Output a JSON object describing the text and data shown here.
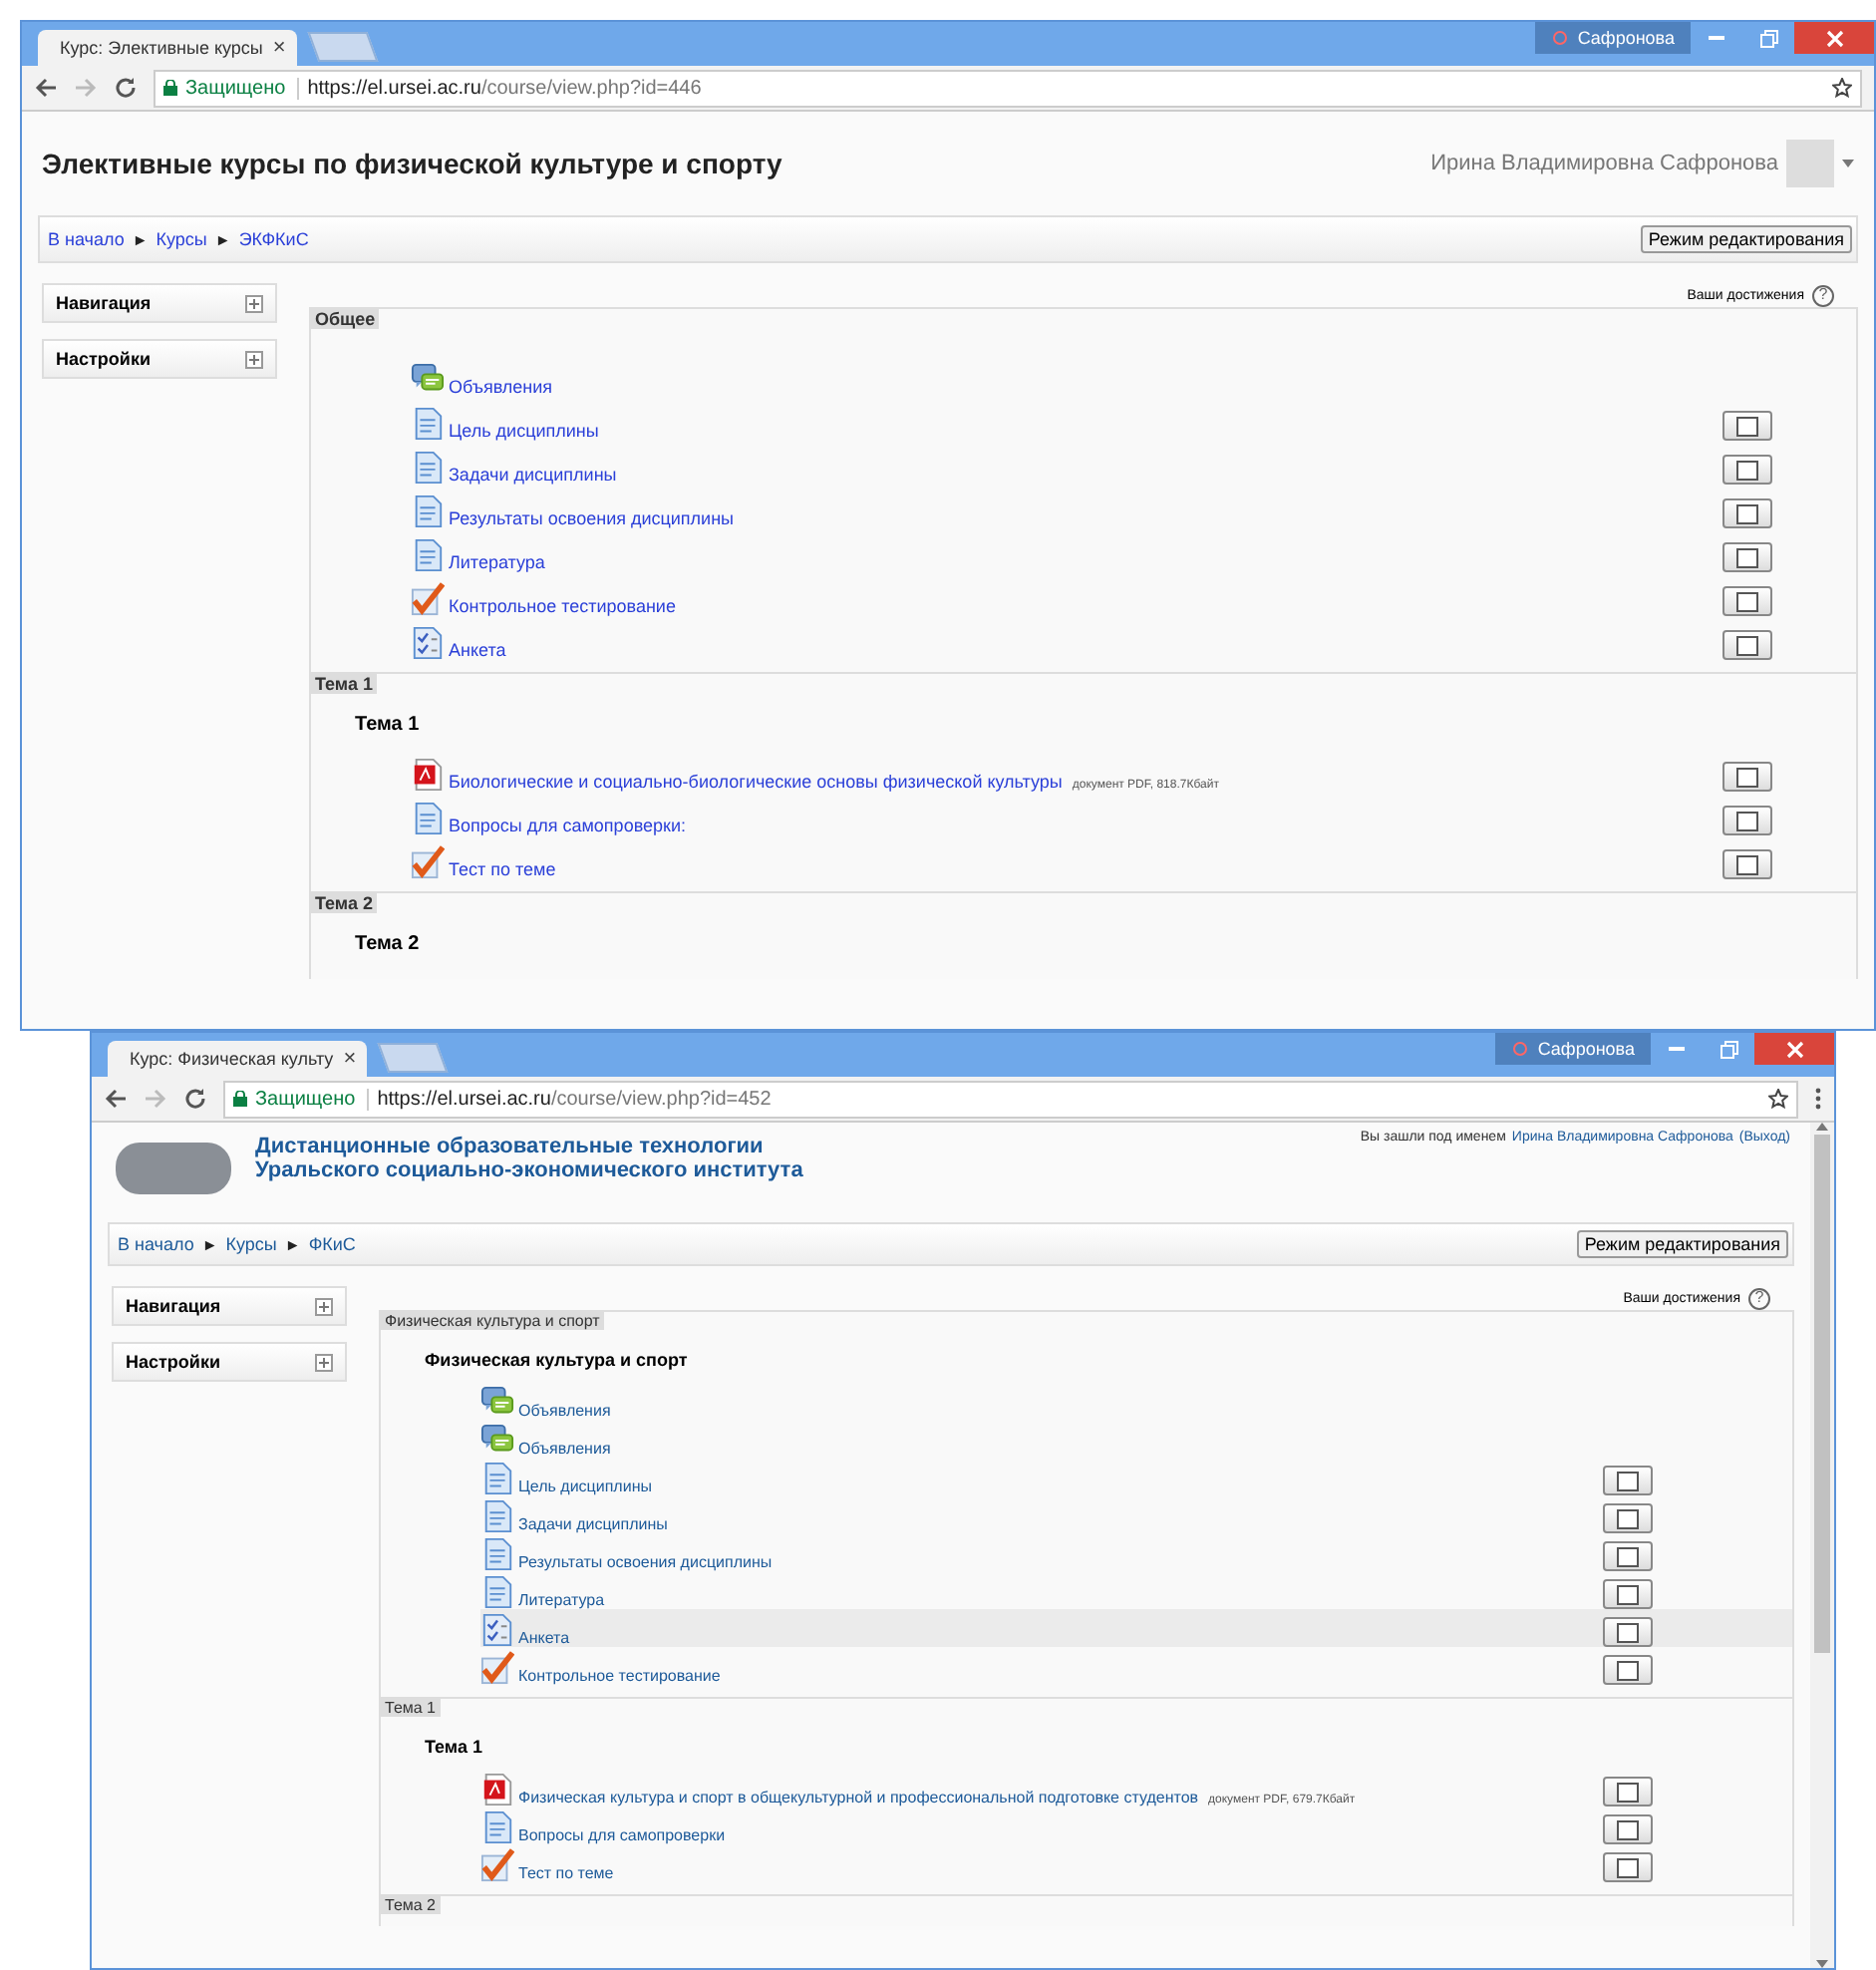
{
  "windows": [
    {
      "kind": "user",
      "tab": {
        "title": "Курс: Элективные курсы",
        "close": "×"
      },
      "profile": "Сафронова",
      "address": {
        "secure": "Защищено",
        "host": "https://el.ursei.ac.ru",
        "path": "/course/view.php?id=446"
      },
      "header": {
        "title": "Элективные курсы по физической культуре и спорту",
        "user": "Ирина Владимировна Сафронова"
      },
      "breadcrumbs": [
        "В начало",
        "Курсы",
        "ЭКФКиС"
      ],
      "breadcrumb_separator": "►",
      "edit_button": "Режим редактирования",
      "blocks": [
        "Навигация",
        "Настройки"
      ],
      "achievements": "Ваши достижения",
      "help": "?",
      "sections": [
        {
          "label": "Общее",
          "activities": [
            {
              "kind": "forum",
              "label": "Объявления",
              "tracking": false,
              "hovered": false
            },
            {
              "kind": "page",
              "label": "Цель дисциплины",
              "tracking": true,
              "checked": false,
              "hovered": false
            },
            {
              "kind": "page",
              "label": "Задачи дисциплины",
              "tracking": true,
              "checked": false,
              "hovered": false
            },
            {
              "kind": "page",
              "label": "Результаты освоения дисциплины",
              "tracking": true,
              "checked": false,
              "hovered": false
            },
            {
              "kind": "page",
              "label": "Литература",
              "tracking": true,
              "checked": false,
              "hovered": false
            },
            {
              "kind": "quiz",
              "label": "Контрольное тестирование",
              "tracking": true,
              "checked": false,
              "hovered": false
            },
            {
              "kind": "feedback",
              "label": "Анкета",
              "tracking": true,
              "checked": false,
              "hovered": false
            }
          ]
        },
        {
          "label": "Тема 1",
          "heading": "Тема 1",
          "activities": [
            {
              "kind": "pdf",
              "label": "Биологические и социально-биологические основы физической культуры",
              "info": "документ PDF, 818.7Кбайт",
              "tracking": true,
              "checked": false,
              "hovered": false
            },
            {
              "kind": "page",
              "label": "Вопросы для самопроверки:",
              "tracking": true,
              "checked": false,
              "hovered": false
            },
            {
              "kind": "quiz",
              "label": "Тест по теме",
              "tracking": true,
              "checked": false,
              "hovered": false
            }
          ]
        },
        {
          "label": "Тема 2",
          "heading": "Тема 2"
        }
      ]
    },
    {
      "kind": "logo",
      "tab": {
        "title": "Курс: Физическая культу",
        "close": "×"
      },
      "profile": "Сафронова",
      "address": {
        "secure": "Защищено",
        "host": "https://el.ursei.ac.ru",
        "path": "/course/view.php?id=452"
      },
      "header": {
        "title_lines": [
          "Дистанционные образовательные технологии",
          "Уральского социально-экономического института"
        ],
        "login_prefix": "Вы зашли под именем",
        "user": "Ирина Владимировна Сафронова",
        "logout": "(Выход)"
      },
      "breadcrumbs": [
        "В начало",
        "Курсы",
        "ФКиС"
      ],
      "breadcrumb_separator": "►",
      "edit_button": "Режим редактирования",
      "blocks": [
        "Навигация",
        "Настройки"
      ],
      "achievements": "Ваши достижения",
      "help": "?",
      "sections": [
        {
          "label": "Физическая культура и спорт",
          "heading": "Физическая культура и спорт",
          "activities": [
            {
              "kind": "forum",
              "label": "Объявления",
              "tracking": false,
              "hovered": false
            },
            {
              "kind": "forum",
              "label": "Объявления",
              "tracking": false,
              "hovered": false
            },
            {
              "kind": "page",
              "label": "Цель дисциплины",
              "tracking": true,
              "checked": false,
              "hovered": false
            },
            {
              "kind": "page",
              "label": "Задачи дисциплины",
              "tracking": true,
              "checked": false,
              "hovered": false
            },
            {
              "kind": "page",
              "label": "Результаты освоения дисциплины",
              "tracking": true,
              "checked": false,
              "hovered": false
            },
            {
              "kind": "page",
              "label": "Литература",
              "tracking": true,
              "checked": false,
              "hovered": false
            },
            {
              "kind": "feedback",
              "label": "Анкета",
              "tracking": true,
              "checked": false,
              "hovered": true
            },
            {
              "kind": "quiz",
              "label": "Контрольное тестирование",
              "tracking": true,
              "checked": false,
              "hovered": false
            }
          ]
        },
        {
          "label": "Тема 1",
          "heading": "Тема 1",
          "activities": [
            {
              "kind": "pdf",
              "label": "Физическая культура и спорт в общекультурной и профессиональной подготовке студентов",
              "info": "документ PDF, 679.7Кбайт",
              "tracking": true,
              "checked": false,
              "hovered": false
            },
            {
              "kind": "page",
              "label": "Вопросы для самопроверки",
              "tracking": true,
              "checked": false,
              "hovered": false
            },
            {
              "kind": "quiz",
              "label": "Тест по теме",
              "tracking": true,
              "checked": false,
              "hovered": false
            }
          ]
        },
        {
          "label": "Тема 2"
        }
      ]
    }
  ]
}
